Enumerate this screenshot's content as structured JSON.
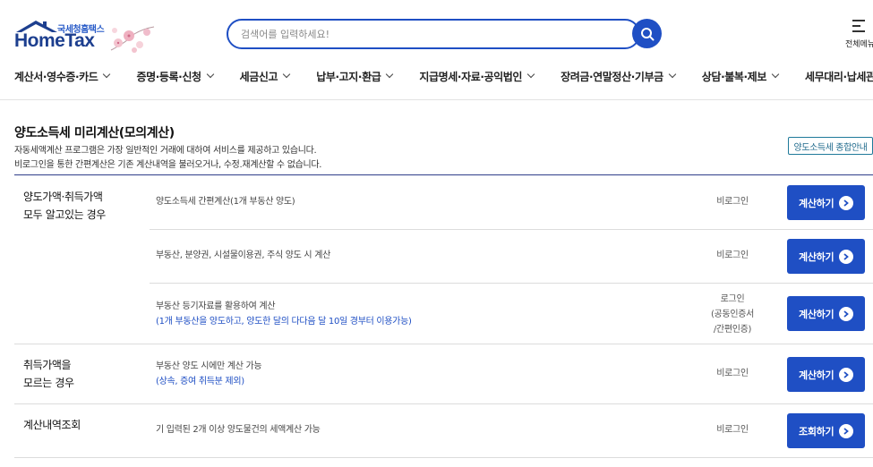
{
  "header": {
    "logo_sub": "국세청홈택스",
    "logo_main": "HomeTax",
    "search_placeholder": "검색어를 입력하세요!",
    "menu_all_label": "전체메뉴"
  },
  "gnb": [
    "계산서·영수증·카드",
    "증명·등록·신청",
    "세금신고",
    "납부·고지·환급",
    "지급명세·자료·공익법인",
    "장려금·연말정산·기부금",
    "상담·불복·제보",
    "세무대리·납세관리"
  ],
  "page": {
    "title": "양도소득세 미리계산(모의계산)",
    "desc1": "자동세액계산 프로그램은 가장 일반적인 거래에 대하여 서비스를 제공하고 있습니다.",
    "desc2": "비로그인을 통한 간편계산은 기존 계산내역을 불러오거나, 수정.재계산할 수 없습니다.",
    "guide_button": "양도소득세 종합안내"
  },
  "groups": {
    "g1_line1": "양도가액·취득가액",
    "g1_line2": "모두 알고있는 경우",
    "g2_line1": "취득가액을",
    "g2_line2": "모르는 경우",
    "g3_line1": "계산내역조회"
  },
  "rows": [
    {
      "text": "양도소득세 간편계산(1개 부동산 양도)",
      "note": "",
      "login": "비로그인",
      "login2": "",
      "login3": "",
      "button": "계산하기"
    },
    {
      "text": "부동산, 분양권, 시설물이용권, 주식 양도 시 계산",
      "note": "",
      "login": "비로그인",
      "login2": "",
      "login3": "",
      "button": "계산하기"
    },
    {
      "text": "부동산 등기자료를 활용하여 계산",
      "note": "(1개 부동산을 양도하고, 양도한 달의 다다음 달 10일 경부터 이용가능)",
      "login": "로그인",
      "login2": "(공동인증서",
      "login3": "/간편인증)",
      "button": "계산하기"
    },
    {
      "text": "부동산 양도 시에만 계산 가능",
      "note": "(상속, 증여 취득분 제외)",
      "login": "비로그인",
      "login2": "",
      "login3": "",
      "button": "계산하기"
    },
    {
      "text": "기 입력된 2개 이상 양도물건의 세액계산 가능",
      "note": "",
      "login": "비로그인",
      "login2": "",
      "login3": "",
      "button": "조회하기"
    }
  ],
  "colors": {
    "brand": "#1f4fc4",
    "logo": "#1d3f8f",
    "table_top": "#2f3e8a"
  }
}
